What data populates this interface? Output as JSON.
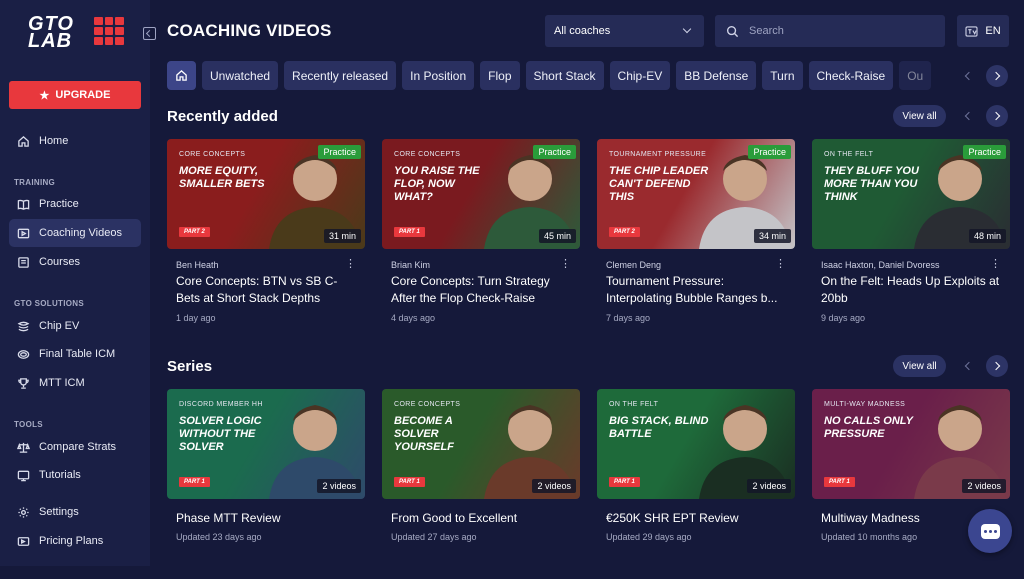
{
  "brand": {
    "logo_text": "GTO LAB",
    "accent": "#e8383d"
  },
  "sidebar": {
    "upgrade_label": "UPGRADE",
    "home": "Home",
    "sections": [
      {
        "heading": "TRAINING",
        "items": [
          "Practice",
          "Coaching Videos",
          "Courses"
        ]
      },
      {
        "heading": "GTO SOLUTIONS",
        "items": [
          "Chip EV",
          "Final Table ICM",
          "MTT ICM"
        ]
      },
      {
        "heading": "TOOLS",
        "items": [
          "Compare Strats",
          "Tutorials"
        ]
      }
    ],
    "footer_items": [
      "Settings",
      "Pricing Plans"
    ],
    "active_item": "Coaching Videos"
  },
  "header": {
    "title": "COACHING VIDEOS",
    "coach_select": "All coaches",
    "search_placeholder": "Search",
    "language": "EN"
  },
  "filter_chips": [
    "Unwatched",
    "Recently released",
    "In Position",
    "Flop",
    "Short Stack",
    "Chip-EV",
    "BB Defense",
    "Turn",
    "Check-Raise",
    "Ou"
  ],
  "recently_added": {
    "title": "Recently added",
    "view_all": "View all",
    "videos": [
      {
        "category": "CORE CONCEPTS",
        "thumb_title": "MORE EQUITY, SMALLER BETS",
        "part": "PART 2",
        "badge": "Practice",
        "duration": "31 min",
        "coach": "Ben Heath",
        "title": "Core Concepts: BTN vs SB C-Bets at Short Stack Depths",
        "ago": "1 day ago",
        "colors": [
          "#8a1d1d",
          "#4a3a1a"
        ]
      },
      {
        "category": "CORE CONCEPTS",
        "thumb_title": "YOU RAISE THE FLOP, NOW WHAT?",
        "part": "PART 1",
        "badge": "Practice",
        "duration": "45 min",
        "coach": "Brian Kim",
        "title": "Core Concepts: Turn Strategy After the Flop Check-Raise",
        "ago": "4 days ago",
        "colors": [
          "#7a1a1f",
          "#2d5a3a"
        ]
      },
      {
        "category": "TOURNAMENT PRESSURE",
        "thumb_title": "THE CHIP LEADER CAN'T DEFEND THIS",
        "part": "PART 2",
        "badge": "Practice",
        "duration": "34 min",
        "coach": "Clemen Deng",
        "title": "Tournament Pressure: Interpolating Bubble Ranges b...",
        "ago": "7 days ago",
        "colors": [
          "#9a2a2e",
          "#c4c4c8"
        ]
      },
      {
        "category": "ON THE FELT",
        "thumb_title": "THEY BLUFF YOU MORE THAN YOU THINK",
        "part": "",
        "badge": "Practice",
        "duration": "48 min",
        "coach": "Isaac Haxton, Daniel Dvoress",
        "title": "On the Felt: Heads Up Exploits at 20bb",
        "ago": "9 days ago",
        "colors": [
          "#1f5a34",
          "#2a2d33"
        ]
      }
    ]
  },
  "series": {
    "title": "Series",
    "view_all": "View all",
    "items": [
      {
        "category": "DISCORD MEMBER HH",
        "thumb_title": "SOLVER LOGIC WITHOUT THE SOLVER",
        "part": "PART 1",
        "count": "2 videos",
        "title": "Phase MTT Review",
        "ago": "Updated 23 days ago",
        "colors": [
          "#1b6b4e",
          "#2e4a6a"
        ]
      },
      {
        "category": "CORE CONCEPTS",
        "thumb_title": "BECOME A SOLVER YOURSELF",
        "part": "PART 1",
        "count": "2 videos",
        "title": "From Good to Excellent",
        "ago": "Updated 27 days ago",
        "colors": [
          "#2a5a2a",
          "#6a3a2a"
        ]
      },
      {
        "category": "ON THE FELT",
        "thumb_title": "BIG STACK, BLIND BATTLE",
        "part": "PART 1",
        "count": "2 videos",
        "title": "€250K SHR EPT Review",
        "ago": "Updated 29 days ago",
        "colors": [
          "#1e6a3a",
          "#1a2e22"
        ]
      },
      {
        "category": "MULTI-WAY MADNESS",
        "thumb_title": "NO CALLS ONLY PRESSURE",
        "part": "PART 1",
        "count": "2 videos",
        "title": "Multiway Madness",
        "ago": "Updated 10 months ago",
        "colors": [
          "#6a1f4a",
          "#7a3a4a"
        ]
      }
    ]
  }
}
